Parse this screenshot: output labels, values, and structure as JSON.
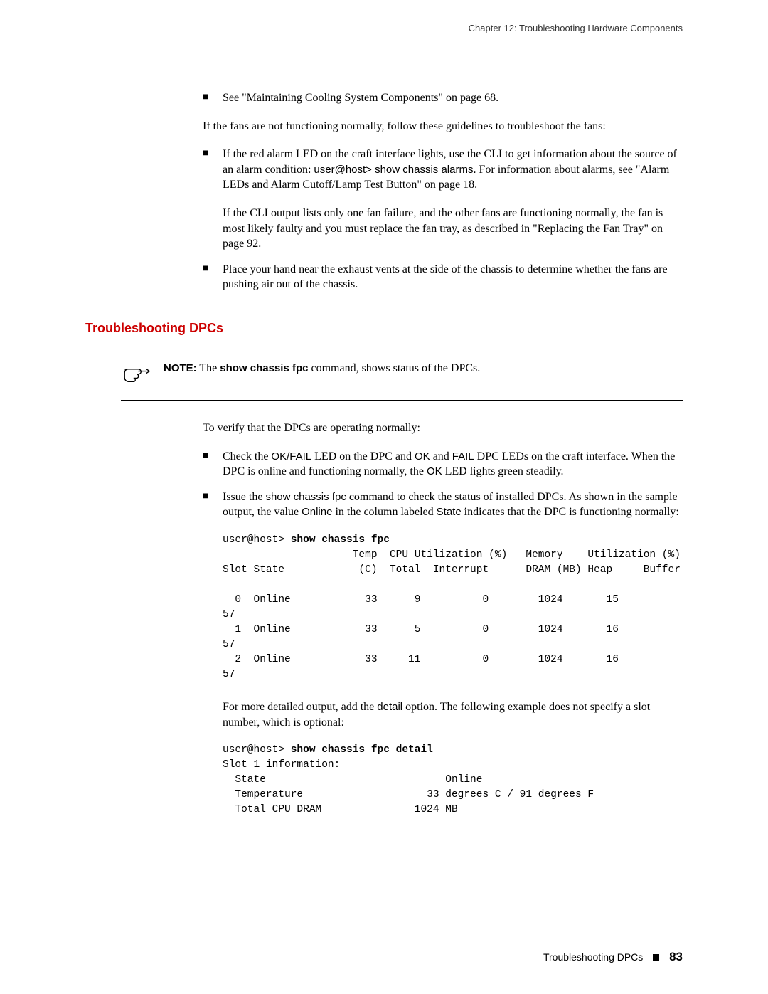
{
  "header": {
    "chapter_line": "Chapter 12: Troubleshooting Hardware Components"
  },
  "top_bullet": {
    "text": "See \"Maintaining Cooling System Components\" on page 68."
  },
  "fans_intro": "If the fans are not functioning normally, follow these guidelines to troubleshoot the fans:",
  "fans_bullet1_a": "If the red alarm LED on the craft interface lights, use the CLI to get information about the source of an alarm condition: ",
  "fans_bullet1_cmd": "user@host> show chassis alarms",
  "fans_bullet1_b": ". For information about alarms, see \"Alarm LEDs and Alarm Cutoff/Lamp Test Button\" on page 18.",
  "fans_bullet1_sub": "If the CLI output lists only one fan failure, and the other fans are functioning normally, the fan is most likely faulty and you must replace the fan tray, as described in \"Replacing the Fan Tray\" on page 92.",
  "fans_bullet2": "Place your hand near the exhaust vents at the side of the chassis to determine whether the fans are pushing air out of the chassis.",
  "section_title": "Troubleshooting DPCs",
  "note": {
    "label": "NOTE:",
    "pre": " The ",
    "cmd": "show chassis fpc",
    "post": " command, shows status of the DPCs."
  },
  "verify_intro": "To verify that the DPCs are operating normally:",
  "dpc_bullet1_a": "Check the ",
  "dpc_bullet1_b": "OK/FAIL",
  "dpc_bullet1_c": " LED on the DPC and ",
  "dpc_bullet1_d": "OK",
  "dpc_bullet1_e": " and ",
  "dpc_bullet1_f": "FAIL",
  "dpc_bullet1_g": " DPC LEDs on the craft interface. When the DPC is online and functioning normally, the ",
  "dpc_bullet1_h": "OK",
  "dpc_bullet1_i": " LED lights green steadily.",
  "dpc_bullet2_a": "Issue the ",
  "dpc_bullet2_b": "show chassis fpc",
  "dpc_bullet2_c": " command to check the status of installed DPCs. As shown in the sample output, the value ",
  "dpc_bullet2_d": "Online",
  "dpc_bullet2_e": " in the column labeled ",
  "dpc_bullet2_f": "State",
  "dpc_bullet2_g": " indicates that the DPC is functioning normally:",
  "code1_prompt": "user@host> ",
  "code1_cmd": "show chassis fpc",
  "code1_body": "\n                     Temp  CPU Utilization (%)   Memory    Utilization (%)\nSlot State            (C)  Total  Interrupt      DRAM (MB) Heap     Buffer\n\n  0  Online            33      9          0        1024       15\n57\n  1  Online            33      5          0        1024       16\n57\n  2  Online            33     11          0        1024       16\n57",
  "detail_a": "For more detailed output, add the ",
  "detail_b": "detail",
  "detail_c": " option. The following example does not specify a slot number, which is optional:",
  "code2_prompt": "user@host> ",
  "code2_cmd": "show chassis fpc detail",
  "code2_body": "\nSlot 1 information:\n  State                             Online\n  Temperature                    33 degrees C / 91 degrees F\n  Total CPU DRAM               1024 MB",
  "footer": {
    "text": "Troubleshooting DPCs",
    "page": "83"
  },
  "chart_data": {
    "type": "table",
    "title": "show chassis fpc",
    "columns": [
      "Slot",
      "State",
      "Temp (C)",
      "CPU Total (%)",
      "CPU Interrupt (%)",
      "Memory DRAM (MB)",
      "Heap (%)",
      "Buffer (%)"
    ],
    "rows": [
      [
        0,
        "Online",
        33,
        9,
        0,
        1024,
        15,
        57
      ],
      [
        1,
        "Online",
        33,
        5,
        0,
        1024,
        16,
        57
      ],
      [
        2,
        "Online",
        33,
        11,
        0,
        1024,
        16,
        57
      ]
    ],
    "detail": {
      "slot": 1,
      "State": "Online",
      "Temperature": "33 degrees C / 91 degrees F",
      "Total CPU DRAM": "1024 MB"
    }
  }
}
